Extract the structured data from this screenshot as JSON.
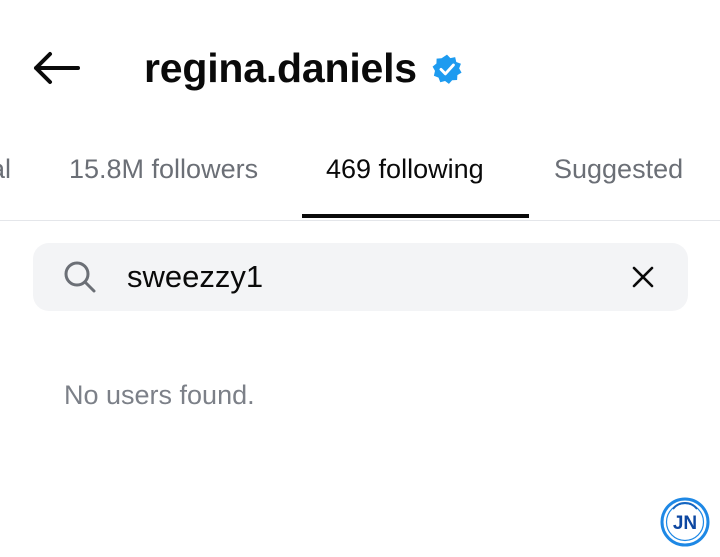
{
  "header": {
    "username": "regina.daniels",
    "verified": true,
    "icons": {
      "back": "arrow-left-icon",
      "verified": "verified-badge-icon"
    },
    "colors": {
      "verified": "#1d9bf0"
    }
  },
  "tabs": [
    {
      "label": "al",
      "active": false
    },
    {
      "label": "15.8M followers",
      "active": false
    },
    {
      "label": "469 following",
      "active": true
    },
    {
      "label": "Suggested",
      "active": false
    }
  ],
  "search": {
    "value": "sweezzy1",
    "placeholder": "Search",
    "icons": {
      "search": "search-icon",
      "clear": "close-icon"
    }
  },
  "results": {
    "empty_message": "No users found."
  },
  "watermark": {
    "text": "JN",
    "icon": "jn-logo-watermark",
    "color": "#1e88e5"
  }
}
